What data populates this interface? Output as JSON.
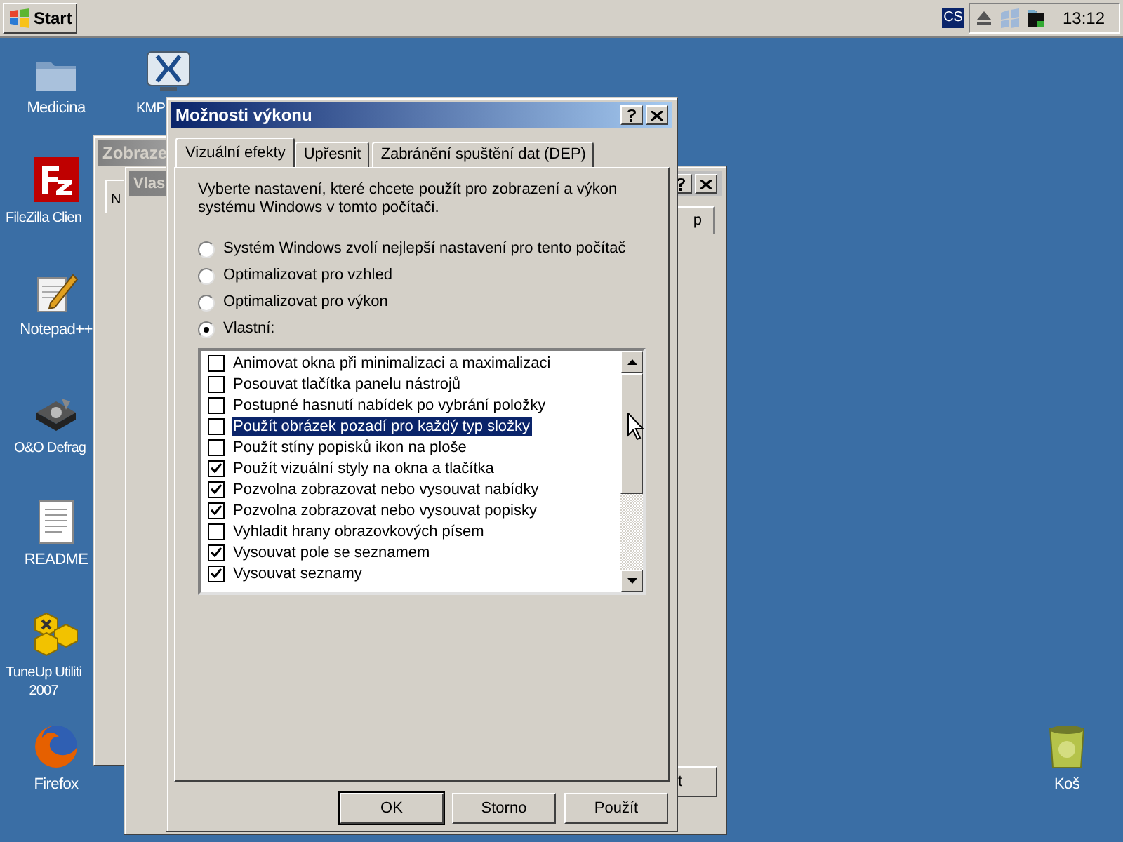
{
  "taskbar": {
    "start_label": "Start",
    "tray_badge": "CS",
    "clock": "13:12"
  },
  "desktop_icons": [
    {
      "kind": "folder",
      "label": "Medicina"
    },
    {
      "kind": "media_player",
      "label": "KMP"
    },
    {
      "kind": "filezilla",
      "label": "FileZilla Clien"
    },
    {
      "kind": "notepad",
      "label": "Notepad++"
    },
    {
      "kind": "defrag",
      "label": "O&O Defrag"
    },
    {
      "kind": "document",
      "label": "README"
    },
    {
      "kind": "tuneup",
      "label": "TuneUp Utiliti\n2007"
    },
    {
      "kind": "firefox",
      "label": "Firefox"
    },
    {
      "kind": "recycle_bin",
      "label": "Koš"
    }
  ],
  "background_windows": [
    {
      "title": "Zobraze",
      "tab_fragment": "N"
    },
    {
      "title": "Vlas",
      "tab_fragment": "p",
      "button_fragment": "t"
    }
  ],
  "dialog": {
    "title": "Možnosti výkonu",
    "tabs": [
      {
        "label": "Vizuální efekty",
        "selected": true
      },
      {
        "label": "Upřesnit",
        "selected": false
      },
      {
        "label": "Zabránění spuštění dat (DEP)",
        "selected": false
      }
    ],
    "description": "Vyberte nastavení, které chcete použít pro zobrazení a výkon systému Windows v tomto počítači.",
    "options": [
      {
        "label": "Systém Windows zvolí nejlepší nastavení pro tento počítač",
        "selected": false
      },
      {
        "label": "Optimalizovat pro vzhled",
        "selected": false
      },
      {
        "label": "Optimalizovat pro výkon",
        "selected": false
      },
      {
        "label": "Vlastní:",
        "selected": true
      }
    ],
    "effects": [
      {
        "label": "Animovat okna při minimalizaci a maximalizaci",
        "checked": false,
        "selected": false
      },
      {
        "label": "Posouvat tlačítka panelu nástrojů",
        "checked": false,
        "selected": false
      },
      {
        "label": "Postupné hasnutí nabídek po vybrání položky",
        "checked": false,
        "selected": false
      },
      {
        "label": "Použít obrázek pozadí pro každý typ složky",
        "checked": false,
        "selected": true
      },
      {
        "label": "Použít stíny popisků ikon na ploše",
        "checked": false,
        "selected": false
      },
      {
        "label": "Použít vizuální styly na okna a tlačítka",
        "checked": true,
        "selected": false
      },
      {
        "label": "Pozvolna zobrazovat nebo vysouvat nabídky",
        "checked": true,
        "selected": false
      },
      {
        "label": "Pozvolna zobrazovat nebo vysouvat popisky",
        "checked": true,
        "selected": false
      },
      {
        "label": "Vyhladit hrany obrazovkových písem",
        "checked": false,
        "selected": false
      },
      {
        "label": "Vysouvat pole se seznamem",
        "checked": true,
        "selected": false
      },
      {
        "label": "Vysouvat seznamy",
        "checked": true,
        "selected": false
      }
    ],
    "buttons": [
      {
        "label": "OK",
        "default": true
      },
      {
        "label": "Storno",
        "default": false
      },
      {
        "label": "Použít",
        "default": false
      }
    ]
  }
}
